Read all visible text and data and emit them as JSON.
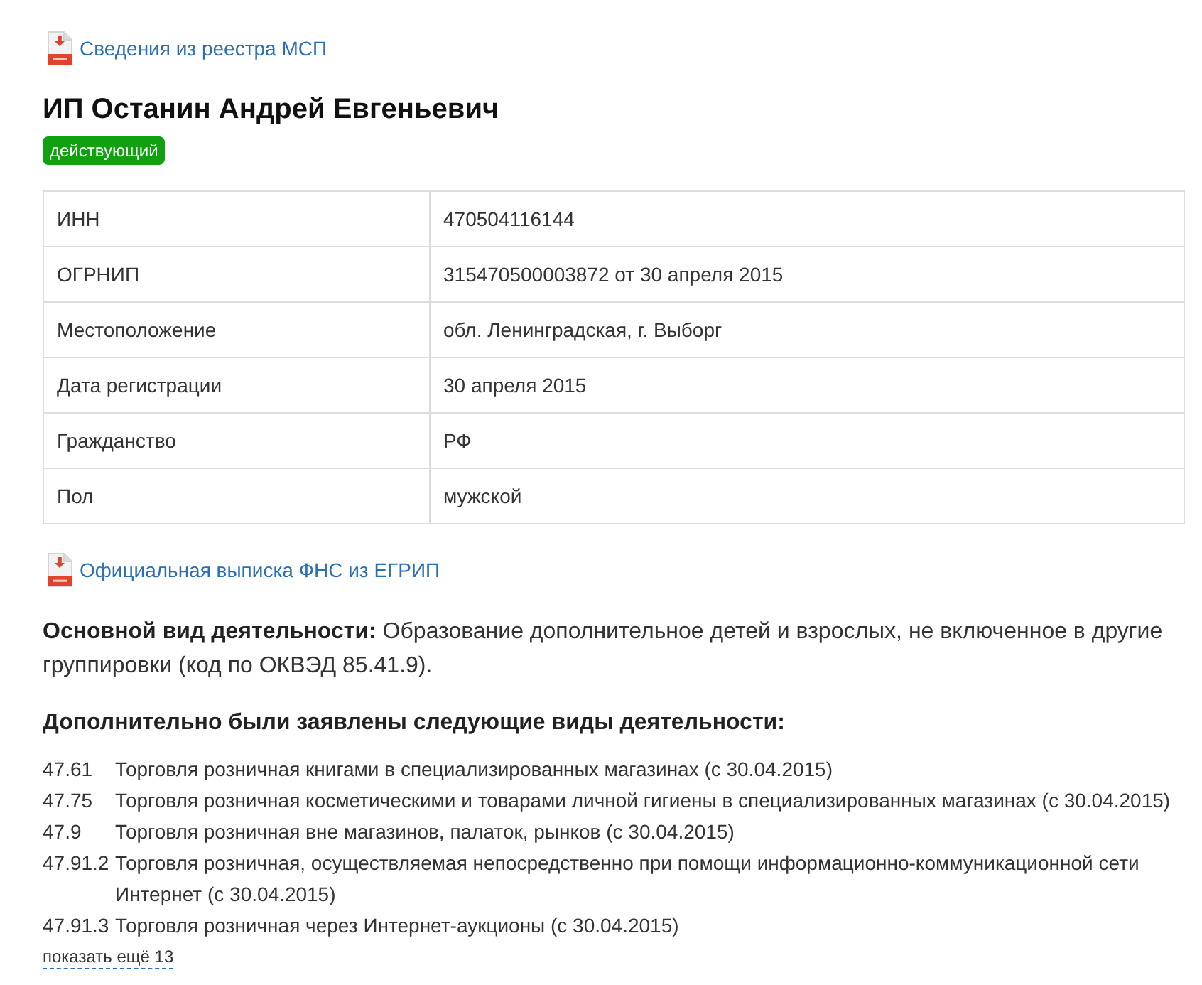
{
  "registry_link": {
    "label": "Сведения из реестра МСП"
  },
  "title": "ИП Останин Андрей Евгеньевич",
  "status": {
    "label": "действующий"
  },
  "details": [
    {
      "label": "ИНН",
      "value": "470504116144"
    },
    {
      "label": "ОГРНИП",
      "value": "315470500003872 от 30 апреля 2015"
    },
    {
      "label": "Местоположение",
      "value": "обл. Ленинградская, г. Выборг"
    },
    {
      "label": "Дата регистрации",
      "value": "30 апреля 2015"
    },
    {
      "label": "Гражданство",
      "value": "РФ"
    },
    {
      "label": "Пол",
      "value": "мужской"
    }
  ],
  "extract_link": {
    "label": "Официальная выписка ФНС из ЕГРИП"
  },
  "main_activity": "**Основной вид деятельности:** Образование дополнительное детей и взрослых, не включенное в другие группировки (код по ОКВЭД 85.41.9).",
  "additional_activities": {
    "heading": "Дополнительно были заявлены следующие виды деятельности:",
    "items": [
      {
        "code": "47.61",
        "text": "Торговля розничная книгами в специализированных магазинах (с 30.04.2015)"
      },
      {
        "code": "47.75",
        "text": "Торговля розничная косметическими и товарами личной гигиены в специализированных магазинах (с 30.04.2015)"
      },
      {
        "code": "47.9",
        "text": "Торговля розничная вне магазинов, палаток, рынков (с 30.04.2015)"
      },
      {
        "code": "47.91.2",
        "text": "Торговля розничная, осуществляемая непосредственно при помощи информационно-коммуникационной сети Интернет (с 30.04.2015)"
      },
      {
        "code": "47.91.3",
        "text": "Торговля розничная через Интернет-аукционы (с 30.04.2015)"
      }
    ],
    "more_link": "показать ещё 13"
  }
}
